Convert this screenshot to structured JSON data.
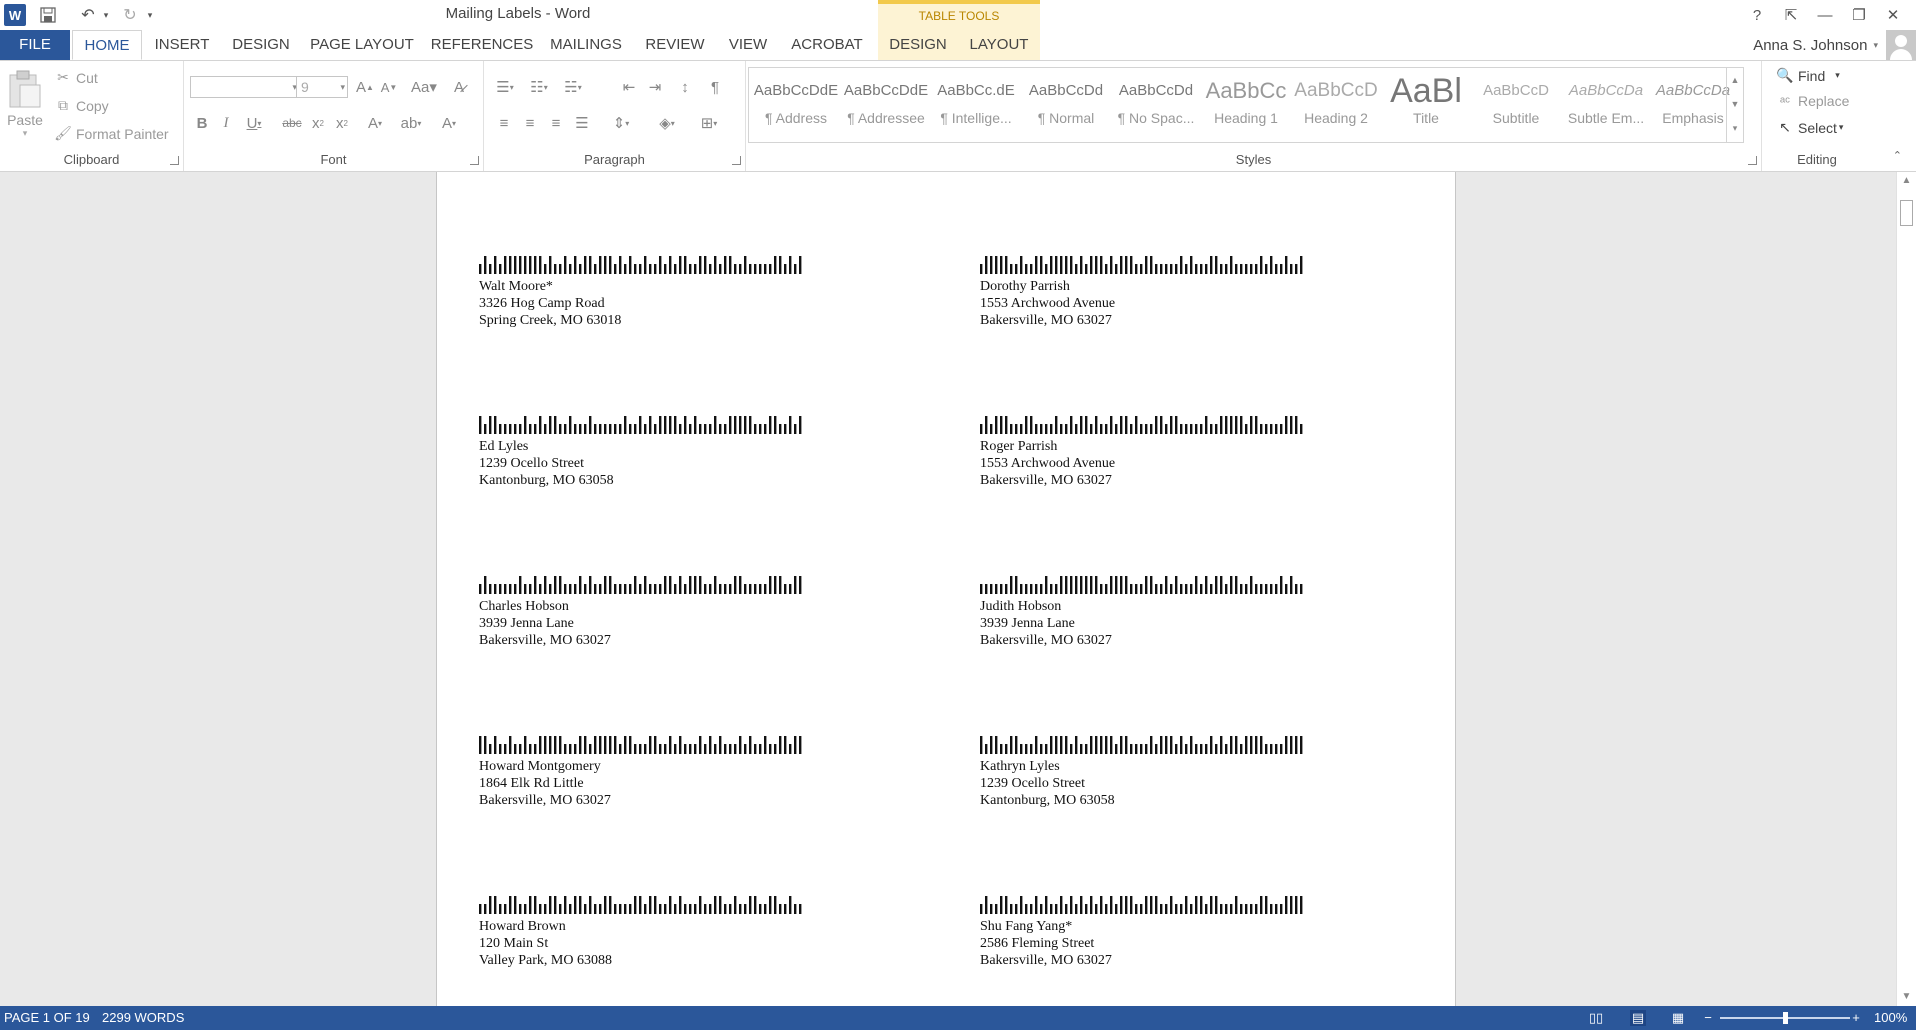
{
  "titlebar": {
    "document_title": "Mailing Labels - Word",
    "contextual_group": "TABLE TOOLS",
    "app_icon": "W",
    "qat_icons": [
      "save-icon",
      "undo-icon",
      "redo-icon",
      "customize-qat-icon"
    ],
    "window_controls": {
      "help": "?",
      "ribbon_display": "⇱",
      "minimize": "—",
      "restore": "❐",
      "close": "✕"
    }
  },
  "tabs": {
    "file": "FILE",
    "home": "HOME",
    "insert": "INSERT",
    "design": "DESIGN",
    "page_layout": "PAGE LAYOUT",
    "references": "REFERENCES",
    "mailings": "MAILINGS",
    "review": "REVIEW",
    "view": "VIEW",
    "acrobat": "ACROBAT",
    "tt_design": "DESIGN",
    "tt_layout": "LAYOUT"
  },
  "user": {
    "name": "Anna S. Johnson"
  },
  "ribbon": {
    "clipboard": {
      "label": "Clipboard",
      "paste": "Paste",
      "cut": "Cut",
      "copy": "Copy",
      "format_painter": "Format Painter"
    },
    "font": {
      "label": "Font",
      "font_name": "",
      "font_size": "9"
    },
    "paragraph": {
      "label": "Paragraph"
    },
    "styles": {
      "label": "Styles",
      "items": [
        {
          "preview": "AaBbCcDdE",
          "name": "¶ Address"
        },
        {
          "preview": "AaBbCcDdE",
          "name": "¶ Addressee"
        },
        {
          "preview": "AaBbCc.dE",
          "name": "¶ Intellige..."
        },
        {
          "preview": "AaBbCcDd",
          "name": "¶ Normal"
        },
        {
          "preview": "AaBbCcDd",
          "name": "¶ No Spac..."
        },
        {
          "preview": "AaBbCc",
          "name": "Heading 1"
        },
        {
          "preview": "AaBbCcD",
          "name": "Heading 2"
        },
        {
          "preview": "AaBl",
          "name": "Title"
        },
        {
          "preview": "AaBbCcD",
          "name": "Subtitle"
        },
        {
          "preview": "AaBbCcDa",
          "name": "Subtle Em..."
        },
        {
          "preview": "AaBbCcDa",
          "name": "Emphasis"
        }
      ]
    },
    "editing": {
      "label": "Editing",
      "find": "Find",
      "replace": "Replace",
      "select": "Select"
    }
  },
  "labels": [
    {
      "name": "Walt Moore*",
      "street": "3326 Hog Camp Road",
      "city": "Spring Creek, MO  63018"
    },
    {
      "name": "Dorothy Parrish",
      "street": "1553 Archwood Avenue",
      "city": "Bakersville, MO  63027"
    },
    {
      "name": "Ed Lyles",
      "street": "1239 Ocello Street",
      "city": "Kantonburg, MO  63058"
    },
    {
      "name": "Roger Parrish",
      "street": "1553 Archwood Avenue",
      "city": "Bakersville, MO  63027"
    },
    {
      "name": "Charles Hobson",
      "street": "3939 Jenna Lane",
      "city": "Bakersville, MO  63027"
    },
    {
      "name": "Judith Hobson",
      "street": "3939 Jenna Lane",
      "city": "Bakersville, MO  63027"
    },
    {
      "name": "Howard Montgomery",
      "street": "1864 Elk Rd Little",
      "city": "Bakersville, MO  63027"
    },
    {
      "name": "Kathryn Lyles",
      "street": "1239 Ocello Street",
      "city": "Kantonburg, MO  63058"
    },
    {
      "name": "Howard Brown",
      "street": "120 Main St",
      "city": "Valley Park, MO  63088"
    },
    {
      "name": "Shu Fang Yang*",
      "street": "2586 Fleming Street",
      "city": "Bakersville, MO  63027"
    }
  ],
  "status": {
    "page": "PAGE 1 OF 19",
    "words": "2299 WORDS",
    "zoom": "100%",
    "zoom_fraction": 0.5
  },
  "colors": {
    "accent": "#2b579a",
    "table_tools": "#fdf3d4",
    "table_tools_text": "#b98600"
  }
}
